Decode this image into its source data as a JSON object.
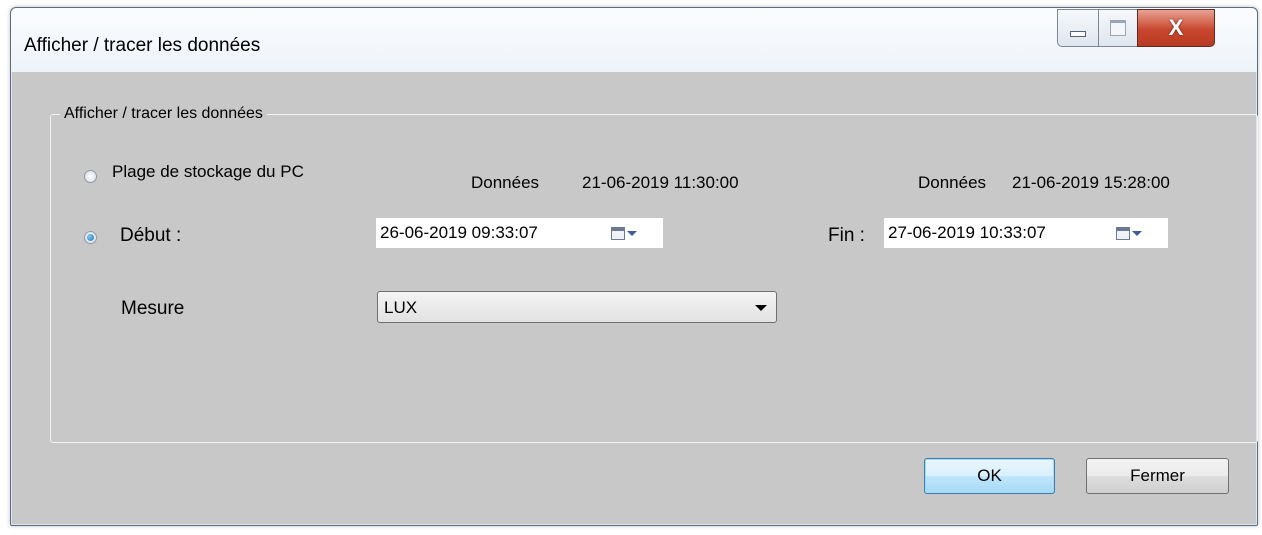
{
  "window": {
    "title": "Afficher / tracer les données",
    "controls": {
      "minimize": "minimize-icon",
      "maximize": "maximize-icon",
      "close": "X"
    }
  },
  "group": {
    "legend": "Afficher / tracer les données",
    "radio_pc": {
      "label": "Plage de stockage du PC",
      "checked": false
    },
    "radio_debut": {
      "label": "Début :",
      "checked": true
    },
    "pc_range": {
      "start_label": "Données",
      "start_value": "21-06-2019 11:30:00",
      "end_label": "Données",
      "end_value": "21-06-2019 15:28:00"
    },
    "debut_value": "26-06-2019 09:33:07",
    "fin_label": "Fin :",
    "fin_value": "27-06-2019 10:33:07",
    "mesure_label": "Mesure",
    "mesure_value": "LUX"
  },
  "buttons": {
    "ok": "OK",
    "fermer": "Fermer"
  },
  "colors": {
    "accent": "#3c7fb1",
    "close_red": "#c9482f",
    "client_bg": "#c8c8c8"
  }
}
